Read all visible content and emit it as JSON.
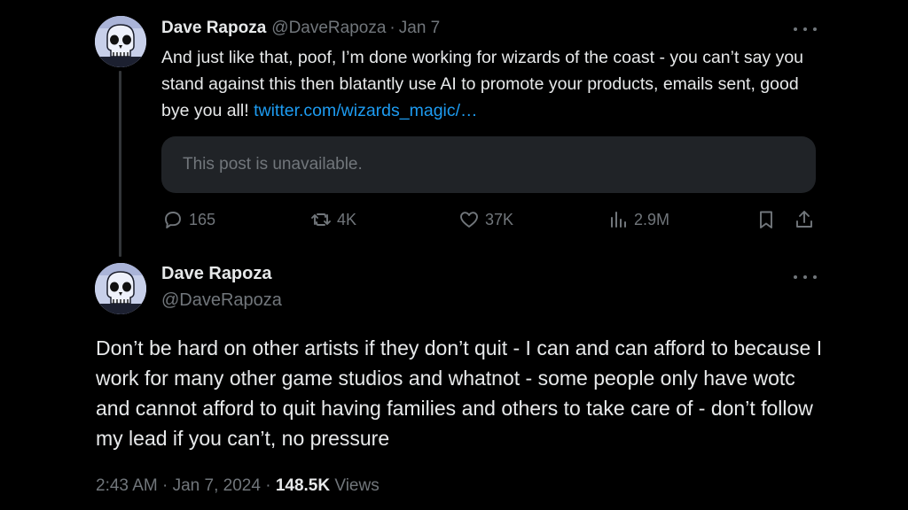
{
  "quoted_post": {
    "author_name": "Dave Rapoza",
    "author_handle": "@DaveRapoza",
    "separator": "·",
    "date": "Jan 7",
    "text": "And just like that, poof, I’m done working for wizards of the coast - you can’t say you stand against this then blatantly use AI to promote your products, emails sent, good bye you all! ",
    "link_text": "twitter.com/wizards_magic/…",
    "embedded_notice": "This post is unavailable.",
    "replies": "165",
    "reposts": "4K",
    "likes": "37K",
    "views": "2.9M"
  },
  "main_post": {
    "author_name": "Dave Rapoza",
    "author_handle": "@DaveRapoza",
    "text": "Don’t be hard on other artists if they don’t quit - I can and can afford to because I work for many other game studios and whatnot - some people only have wotc and cannot afford to quit having families and others to take care of - don’t follow my lead if you can’t, no pressure",
    "time": "2:43 AM",
    "separator_1": "·",
    "date": "Jan 7, 2024",
    "separator_2": "·",
    "views_count": "148.5K",
    "views_label": "Views"
  },
  "icons": {
    "reply": "reply-icon",
    "repost": "repost-icon",
    "like": "heart-icon",
    "views": "analytics-icon",
    "bookmark": "bookmark-icon",
    "share": "share-icon",
    "more": "more-icon"
  },
  "colors": {
    "background": "#000000",
    "text_primary": "#e7e9ea",
    "text_secondary": "#71767b",
    "link": "#1d9bf0",
    "quote_box": "#202327"
  }
}
